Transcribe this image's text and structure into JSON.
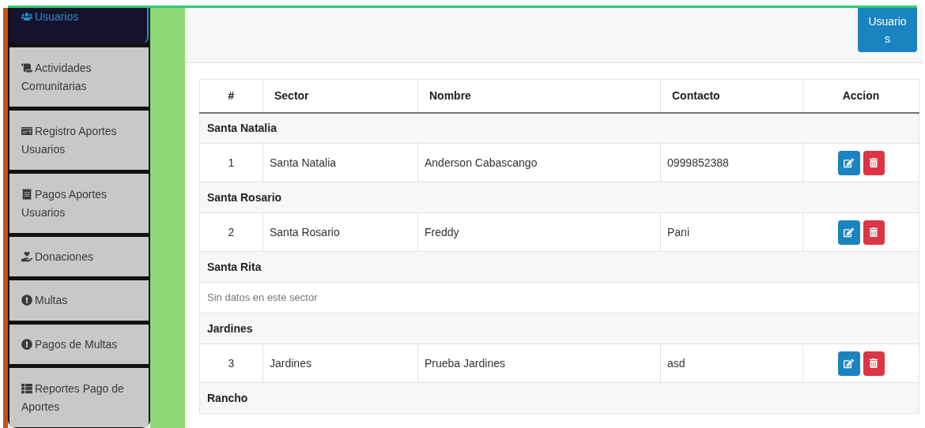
{
  "sidebar": {
    "items": [
      {
        "label": "Usuarios",
        "selected": true
      },
      {
        "label": "Actividades Comunitarias",
        "selected": false
      },
      {
        "label": "Registro Aportes Usuarios",
        "selected": false
      },
      {
        "label": "Pagos Aportes Usuarios",
        "selected": false
      },
      {
        "label": "Donaciones",
        "selected": false
      },
      {
        "label": "Multas",
        "selected": false
      },
      {
        "label": "Pagos de Multas",
        "selected": false
      },
      {
        "label": "Reportes Pago de Aportes",
        "selected": false
      }
    ]
  },
  "header": {
    "button": "Usuarios"
  },
  "table": {
    "columns": [
      "#",
      "Sector",
      "Nombre",
      "Contacto",
      "Accion"
    ],
    "groups": [
      {
        "name": "Santa Natalia",
        "rows": [
          {
            "number": "1",
            "sector": "Santa Natalia",
            "nombre": "Anderson Cabascango",
            "contacto": "0999852388"
          }
        ]
      },
      {
        "name": "Santa Rosario",
        "rows": [
          {
            "number": "2",
            "sector": "Santa Rosario",
            "nombre": "Freddy",
            "contacto": "Pani"
          }
        ]
      },
      {
        "name": "Santa Rita",
        "empty": "Sin datos en este sector"
      },
      {
        "name": "Jardines",
        "rows": [
          {
            "number": "3",
            "sector": "Jardines",
            "nombre": "Prueba Jardines",
            "contacto": "asd"
          }
        ]
      },
      {
        "name": "Rancho"
      }
    ]
  }
}
